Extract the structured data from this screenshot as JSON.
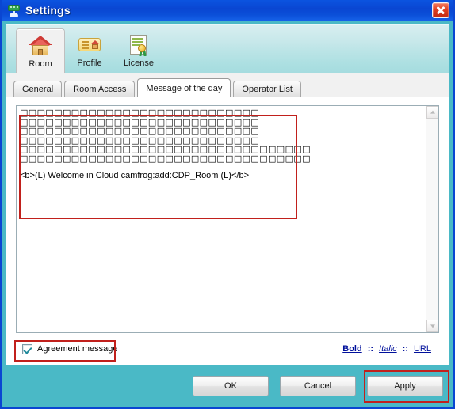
{
  "window": {
    "title": "Settings",
    "icon": "webcam-user-icon",
    "close_label": "Close"
  },
  "toolbar": {
    "items": [
      {
        "label": "Room",
        "icon": "house-icon",
        "active": true
      },
      {
        "label": "Profile",
        "icon": "id-card-icon",
        "active": false
      },
      {
        "label": "License",
        "icon": "certificate-icon",
        "active": false
      }
    ]
  },
  "tabs": [
    {
      "label": "General",
      "selected": false
    },
    {
      "label": "Room Access",
      "selected": false
    },
    {
      "label": "Message of the day",
      "selected": true
    },
    {
      "label": "Operator List",
      "selected": false
    }
  ],
  "editor": {
    "box_rows": [
      "□□□□□□□□□□□□□□□□□□□□□□□□□□□□",
      "□□□□□□□□□□□□□□□□□□□□□□□□□□□□",
      "□□□□□□□□□□□□□□□□□□□□□□□□□□□□",
      "□□□□□□□□□□□□□□□□□□□□□□□□□□□□",
      "□□□□□□□□□□□□□□□□□□□□□□□□□□□□□□□□□□",
      "□□□□□□□□□□□□□□□□□□□□□□□□□□□□□□□□□□"
    ],
    "message_line": "<b>(L) Welcome in Cloud camfrog:add:CDP_Room (L)</b>"
  },
  "options": {
    "agreement_message": {
      "label": "Agreement message",
      "checked": true
    }
  },
  "format_links": {
    "bold": "Bold",
    "italic": "Italic",
    "url": "URL",
    "separator": "::"
  },
  "buttons": {
    "ok": "OK",
    "cancel": "Cancel",
    "apply": "Apply"
  },
  "annotations": {
    "color": "#c1201c",
    "regions": [
      "message-text-region",
      "agreement-checkbox-region",
      "apply-button-region"
    ]
  }
}
